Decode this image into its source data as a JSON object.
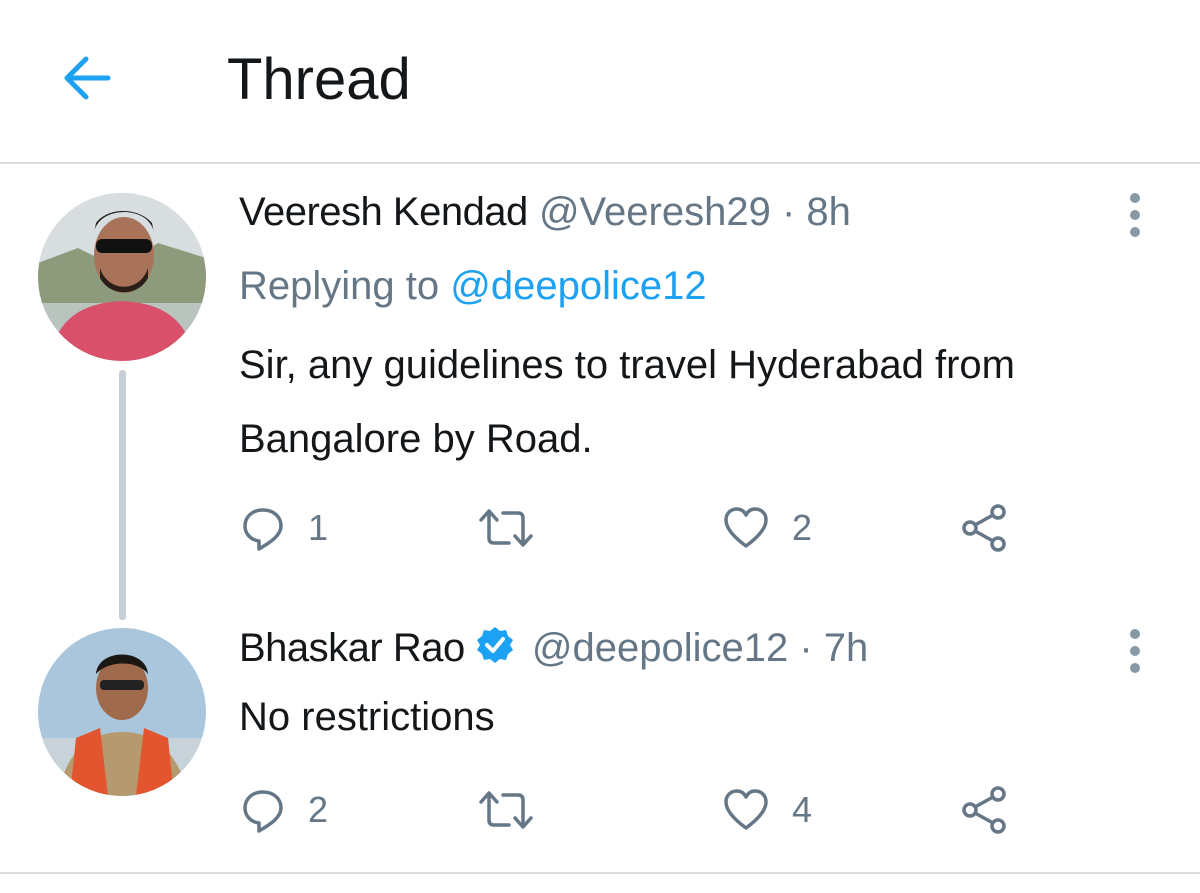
{
  "header": {
    "title": "Thread",
    "back_icon": "arrow-left-icon",
    "accent": "#1da1f2"
  },
  "tweets": [
    {
      "name": "Veeresh Kendad",
      "handle": "@Veeresh29",
      "separator": "·",
      "time": "8h",
      "replying_prefix": "Replying to",
      "replying_to": "@deepolice12",
      "text": "Sir, any guidelines to travel Hyderabad from Bangalore by Road.",
      "replies": "1",
      "retweets": "",
      "likes": "2",
      "verified": false
    },
    {
      "name": "Bhaskar Rao",
      "handle": "@deepolice12",
      "separator": "·",
      "time": "7h",
      "text": "No restrictions",
      "replies": "2",
      "retweets": "",
      "likes": "4",
      "verified": true
    }
  ],
  "icons": {
    "reply": "reply-icon",
    "retweet": "retweet-icon",
    "like": "heart-icon",
    "share": "share-icon",
    "more": "more-vertical-icon",
    "verified": "verified-badge-icon"
  },
  "colors": {
    "text": "#14171a",
    "secondary": "#657786",
    "link": "#1da1f2",
    "border": "#d9dde1"
  }
}
